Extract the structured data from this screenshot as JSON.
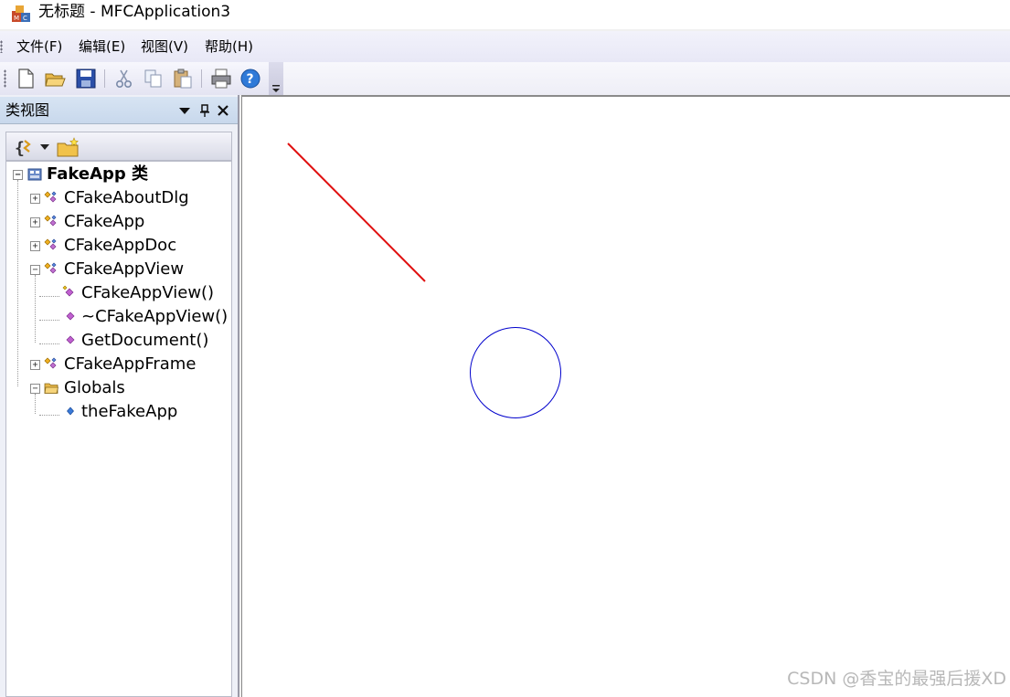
{
  "window": {
    "title": "无标题 - MFCApplication3",
    "app_icon": "mfc-app-icon"
  },
  "menu": {
    "items": [
      {
        "label": "文件(F)"
      },
      {
        "label": "编辑(E)"
      },
      {
        "label": "视图(V)"
      },
      {
        "label": "帮助(H)"
      }
    ]
  },
  "toolbar": {
    "buttons": [
      {
        "icon": "new-file-icon"
      },
      {
        "icon": "open-folder-icon"
      },
      {
        "icon": "save-icon"
      },
      {
        "icon": "cut-icon"
      },
      {
        "icon": "copy-icon"
      },
      {
        "icon": "paste-icon"
      },
      {
        "icon": "print-icon"
      },
      {
        "icon": "help-icon"
      }
    ]
  },
  "class_view": {
    "title": "类视图",
    "tree": [
      {
        "label": "FakeApp 类",
        "icon": "project-icon"
      },
      {
        "label": "CFakeAboutDlg",
        "icon": "class-icon"
      },
      {
        "label": "CFakeApp",
        "icon": "class-icon"
      },
      {
        "label": "CFakeAppDoc",
        "icon": "class-icon"
      },
      {
        "label": "CFakeAppView",
        "icon": "class-icon"
      },
      {
        "label": "CFakeAppView()",
        "icon": "method-icon"
      },
      {
        "label": "~CFakeAppView()",
        "icon": "method-icon"
      },
      {
        "label": "GetDocument()",
        "icon": "method-icon"
      },
      {
        "label": "CFakeAppFrame",
        "icon": "class-icon"
      },
      {
        "label": "Globals",
        "icon": "folder-icon"
      },
      {
        "label": "theFakeApp",
        "icon": "variable-icon"
      }
    ]
  },
  "canvas": {
    "line_color": "#e01010",
    "circle_color": "#0000cc"
  },
  "watermark": "CSDN @香宝的最强后援XD"
}
